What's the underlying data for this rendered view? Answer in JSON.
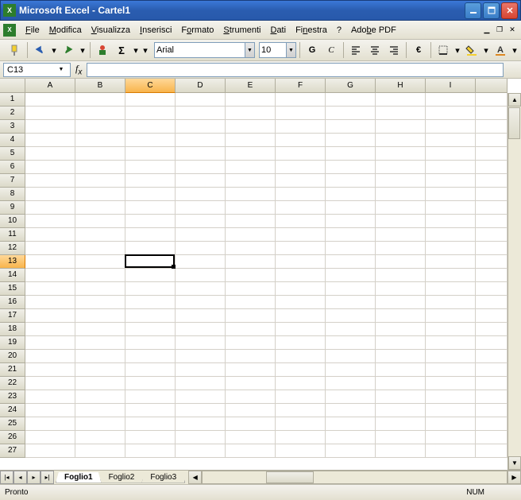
{
  "title": "Microsoft Excel - Cartel1",
  "menu": {
    "file": "File",
    "modifica": "Modifica",
    "visualizza": "Visualizza",
    "inserisci": "Inserisci",
    "formato": "Formato",
    "strumenti": "Strumenti",
    "dati": "Dati",
    "finestra": "Finestra",
    "help": "?",
    "adobe": "Adobe PDF"
  },
  "toolbar": {
    "font": "Arial",
    "size": "10"
  },
  "namebox": "C13",
  "columns": [
    "A",
    "B",
    "C",
    "D",
    "E",
    "F",
    "G",
    "H",
    "I"
  ],
  "rows": [
    "1",
    "2",
    "3",
    "4",
    "5",
    "6",
    "7",
    "8",
    "9",
    "10",
    "11",
    "12",
    "13",
    "14",
    "15",
    "16",
    "17",
    "18",
    "19",
    "20",
    "21",
    "22",
    "23",
    "24",
    "25",
    "26",
    "27"
  ],
  "selected": {
    "col": "C",
    "row": "13",
    "colIndex": 2,
    "rowIndex": 12
  },
  "sheets": [
    "Foglio1",
    "Foglio2",
    "Foglio3"
  ],
  "activeSheet": 0,
  "status": {
    "ready": "Pronto",
    "num": "NUM"
  }
}
